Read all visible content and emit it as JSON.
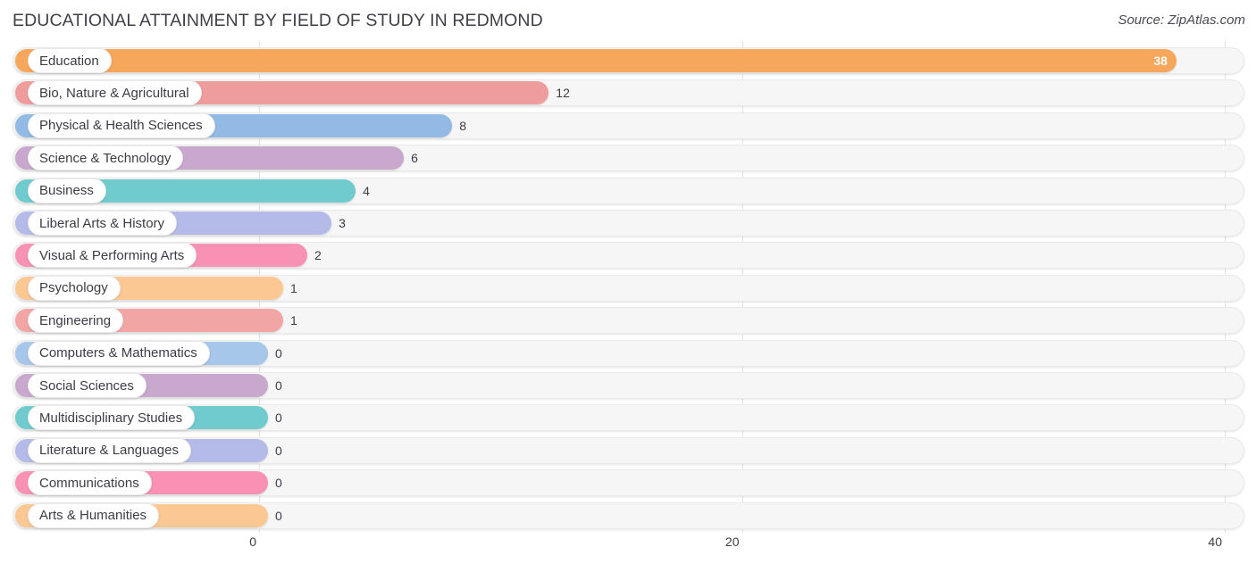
{
  "header": {
    "title": "EDUCATIONAL ATTAINMENT BY FIELD OF STUDY IN REDMOND",
    "source": "Source: ZipAtlas.com"
  },
  "chart_data": {
    "type": "bar",
    "orientation": "horizontal",
    "title": "EDUCATIONAL ATTAINMENT BY FIELD OF STUDY IN REDMOND",
    "xlabel": "",
    "ylabel": "",
    "xlim": [
      0,
      40
    ],
    "xticks": [
      0,
      20,
      40
    ],
    "xtick_labels": [
      "0",
      "20",
      "40"
    ],
    "grid": true,
    "legend": false,
    "categories": [
      "Education",
      "Bio, Nature & Agricultural",
      "Physical & Health Sciences",
      "Science & Technology",
      "Business",
      "Liberal Arts & History",
      "Visual & Performing Arts",
      "Psychology",
      "Engineering",
      "Computers & Mathematics",
      "Social Sciences",
      "Multidisciplinary Studies",
      "Literature & Languages",
      "Communications",
      "Arts & Humanities"
    ],
    "values": [
      38,
      12,
      8,
      6,
      4,
      3,
      2,
      1,
      1,
      0,
      0,
      0,
      0,
      0,
      0
    ],
    "value_labels": [
      "38",
      "12",
      "8",
      "6",
      "4",
      "3",
      "2",
      "1",
      "1",
      "0",
      "0",
      "0",
      "0",
      "0",
      "0"
    ],
    "colors": [
      "#f7a75b",
      "#ee9c9c",
      "#93bae4",
      "#c9a8ce",
      "#6fcbce",
      "#b4bbe8",
      "#f991b5",
      "#fbc894",
      "#f2a5a5",
      "#a6c6ea",
      "#c9a8ce",
      "#6fcbce",
      "#b4bbe8",
      "#f991b5",
      "#fbc894"
    ]
  },
  "colors": {
    "track_background": "#f6f6f6",
    "gridline": "#e3e3e3",
    "text": "#3c3c45",
    "page_background": "#ffffff"
  }
}
